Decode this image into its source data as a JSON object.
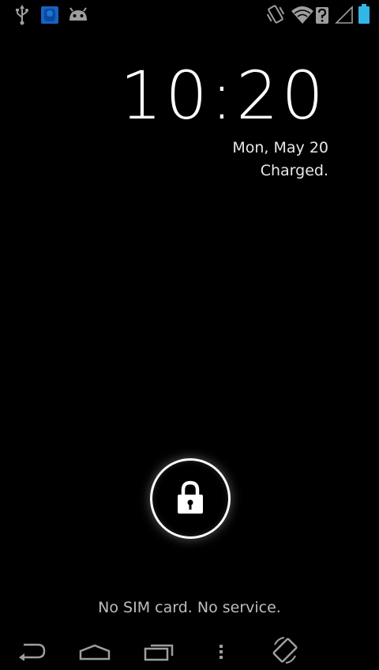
{
  "status_bar": {
    "left_icons": [
      "usb-icon",
      "notification-app-icon",
      "android-debug-icon"
    ],
    "right_icons": [
      "vibrate-icon",
      "wifi-icon",
      "no-signal-icon",
      "battery-icon"
    ],
    "colors": {
      "status_icon": "#9e9e9e",
      "battery": "#33b5e5",
      "app_icon": "#1565c0"
    }
  },
  "lockscreen": {
    "clock": "10:20",
    "date": "Mon, May 20",
    "charge_status": "Charged.",
    "carrier": "No SIM card. No service."
  },
  "nav_bar": {
    "buttons": [
      "back-icon",
      "home-icon",
      "recent-apps-icon",
      "menu-icon",
      "rotate-icon"
    ]
  }
}
